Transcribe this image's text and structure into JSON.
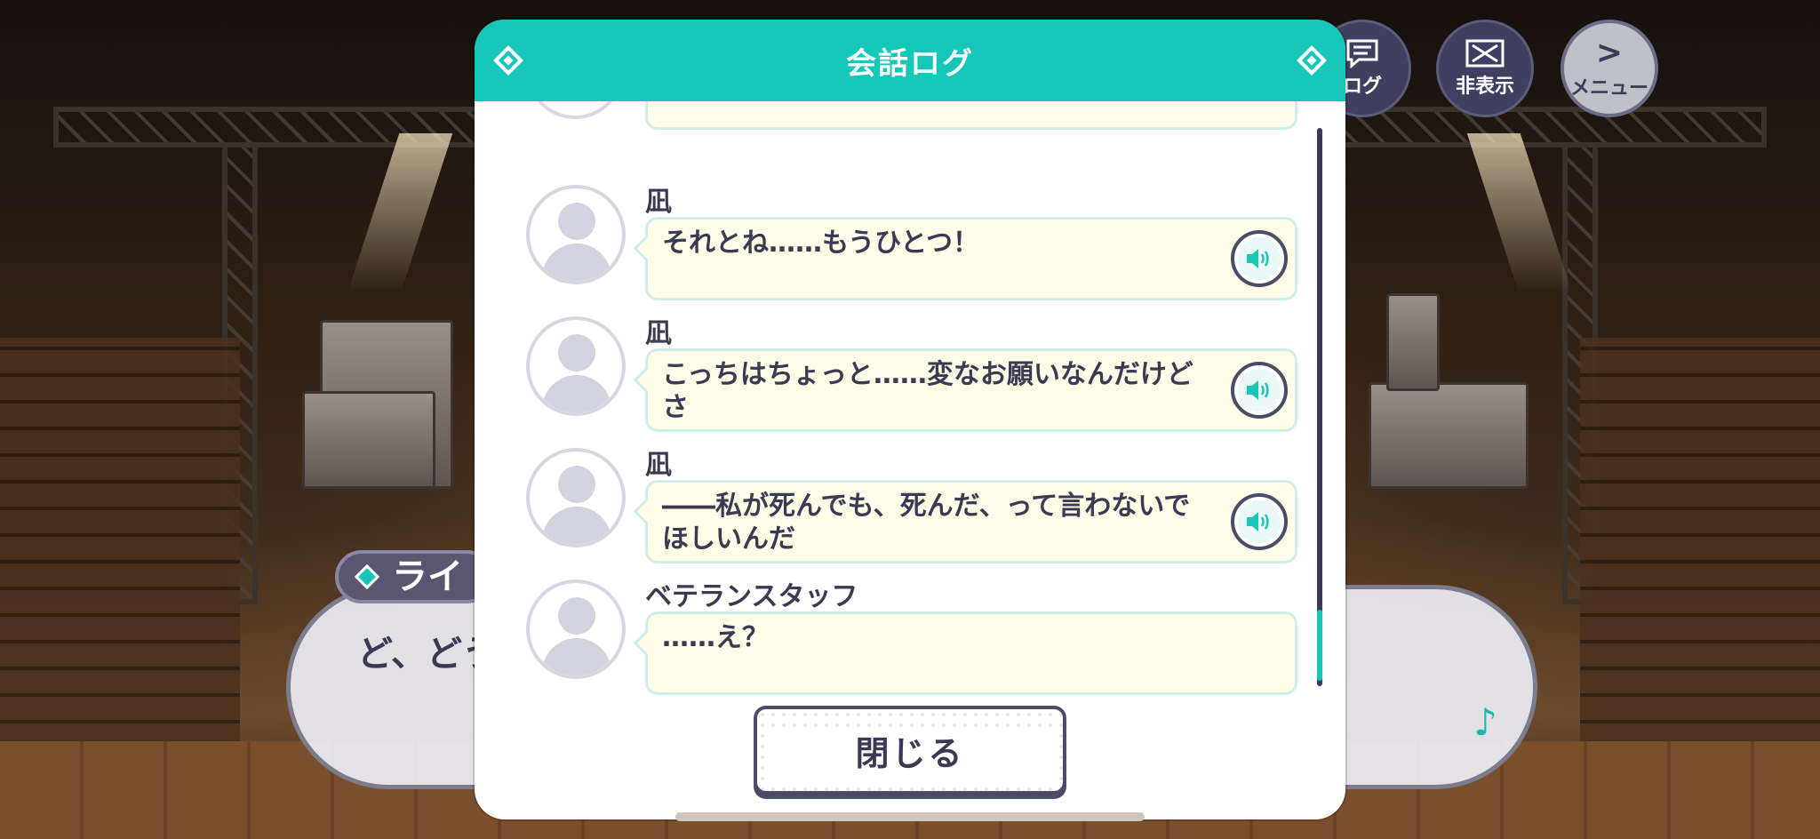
{
  "background_top_buttons": {
    "log_label": "ログ",
    "hide_label": "非表示",
    "menu_label": "メニュー",
    "menu_glyph": ">"
  },
  "underlying_dialogue": {
    "speaker_partial": "ライ",
    "text_partial": "ど、どう"
  },
  "modal": {
    "title": "会話ログ",
    "close_label": "閉じる",
    "accent_color": "#16c6b8"
  },
  "log_entries": [
    {
      "speaker": "凪",
      "text": "それとね……もうひとつ！",
      "has_voice": true
    },
    {
      "speaker": "凪",
      "text": "こっちはちょっと……変なお願いなんだけどさ",
      "has_voice": true
    },
    {
      "speaker": "凪",
      "text": "――私が死んでも、死んだ、って言わないでほしいんだ",
      "has_voice": true
    },
    {
      "speaker": "ベテランスタッフ",
      "text": "……え？",
      "has_voice": false
    }
  ],
  "icons": {
    "log": "chat-bubble-icon",
    "hide": "x-box-icon",
    "menu": "chevron-right-icon",
    "voice": "speaker-icon",
    "note": "music-note-icon"
  }
}
